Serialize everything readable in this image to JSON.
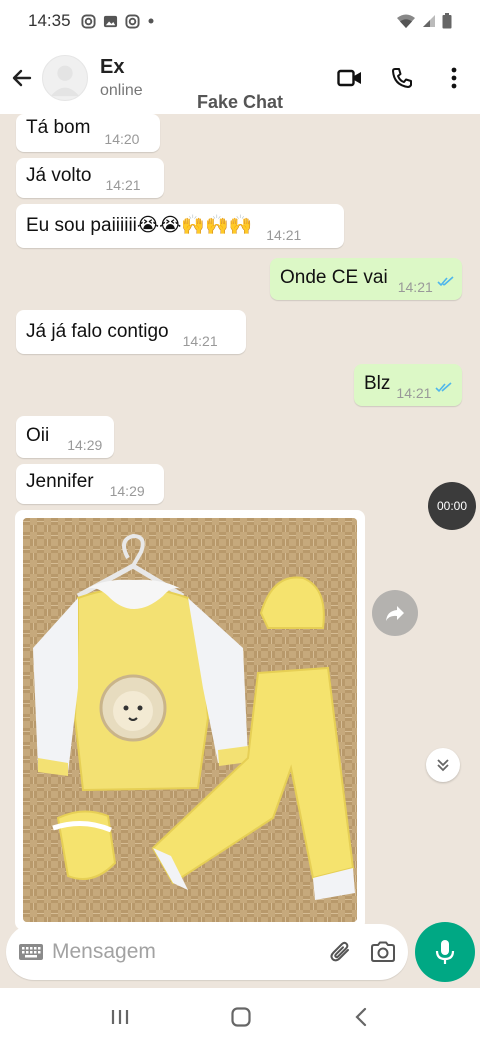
{
  "status_bar": {
    "time": "14:35"
  },
  "header": {
    "contact_name": "Ex",
    "contact_status": "online",
    "app_label": "Fake Chat"
  },
  "messages": [
    {
      "dir": "in",
      "text": "Tá bom",
      "time": "14:20"
    },
    {
      "dir": "in",
      "text": "Já volto",
      "time": "14:21"
    },
    {
      "dir": "in",
      "text": "Eu sou paiiiiii😭😭🙌🙌🙌",
      "time": "14:21"
    },
    {
      "dir": "out",
      "text": "Onde CE vai",
      "time": "14:21"
    },
    {
      "dir": "in",
      "text": "Já já falo contigo",
      "time": "14:21"
    },
    {
      "dir": "out",
      "text": "Blz",
      "time": "14:21"
    },
    {
      "dir": "in",
      "text": "Oii",
      "time": "14:29"
    },
    {
      "dir": "in",
      "text": "Jennifer",
      "time": "14:29"
    }
  ],
  "media": {
    "timer": "00:00"
  },
  "composer": {
    "placeholder": "Mensagem"
  },
  "colors": {
    "chat_bg": "#ede5dc",
    "outgoing_bubble": "#dcf8c6",
    "incoming_bubble": "#ffffff",
    "accent": "#00a884",
    "read_ticks": "#4fb6ec"
  },
  "icons": [
    "back-arrow-icon",
    "video-call-icon",
    "phone-icon",
    "more-icon",
    "keyboard-icon",
    "attach-icon",
    "camera-icon",
    "mic-icon",
    "forward-icon",
    "chevron-double-down-icon",
    "double-check-icon"
  ]
}
